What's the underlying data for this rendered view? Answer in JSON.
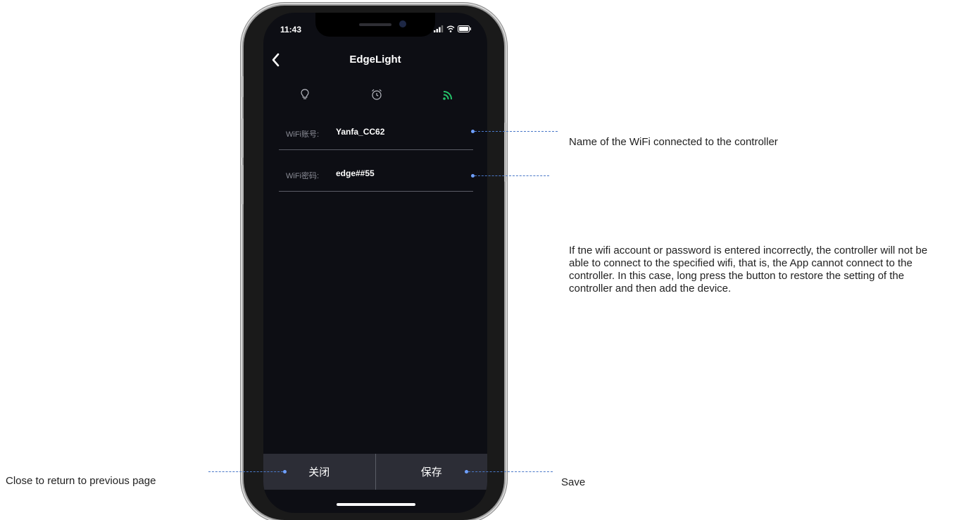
{
  "status_bar": {
    "time": "11:43"
  },
  "app": {
    "title": "EdgeLight"
  },
  "tabs": [
    {
      "icon": "lightbulb-icon",
      "active": false
    },
    {
      "icon": "alarm-clock-icon",
      "active": false
    },
    {
      "icon": "wifi-signal-icon",
      "active": true
    }
  ],
  "colors": {
    "active_tab": "#25c26a",
    "screen_bg": "#0d0e14",
    "bottom_bar": "#2c2d36",
    "annotation_line": "#4a78c8"
  },
  "wifi": {
    "account_label": "WiFi账号:",
    "account_value": "Yanfa_CC62",
    "password_label": "WiFi密码:",
    "password_value": "edge##55"
  },
  "bottom_bar": {
    "close_label": "关闭",
    "save_label": "保存"
  },
  "annotations": {
    "wifi_name": "Name of the WiFi connected to the controller",
    "wifi_error": "If tne wifi account or password is entered incorrectly, the controller will not be able to connect to the specified wifi, that is, the App cannot connect to the controller. In this case, long press the button to restore the setting of the controller and then add the device.",
    "close": "Close to return to previous page",
    "save": "Save"
  }
}
